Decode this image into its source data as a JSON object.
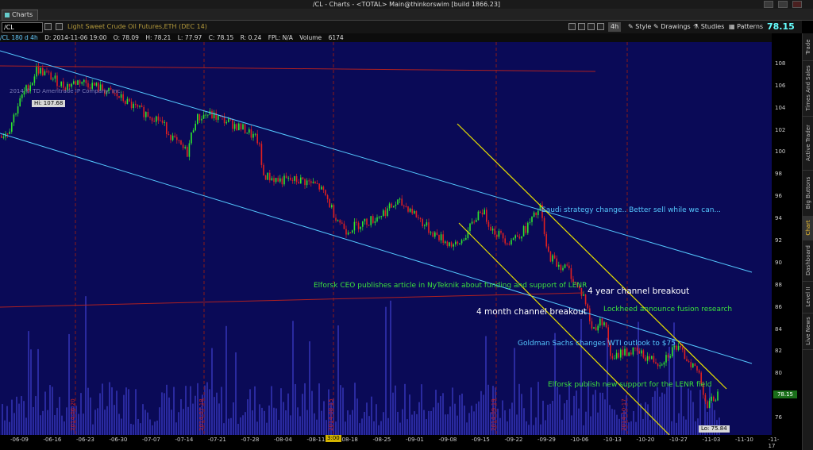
{
  "window": {
    "title": "/CL - Charts - <TOTAL> Main@thinkorswim [build 1866.23]"
  },
  "tab": {
    "label": "Charts"
  },
  "toolbar": {
    "symbol": "/CL",
    "description": "Light Sweet Crude Oil Futures,ETH (DEC 14)",
    "timeframe": "4h",
    "style": "Style",
    "drawings": "Drawings",
    "studies": "Studies",
    "patterns": "Patterns",
    "last_price": "78.15"
  },
  "info": {
    "series": "/CL 180 d 4h",
    "date": "D: 2014-11-06 19:00",
    "open": "O: 78.09",
    "high": "H: 78.21",
    "low": "L: 77.97",
    "close": "C: 78.15",
    "range": "R: 0.24",
    "fpl": "FPL: N/A",
    "volume": "Volume",
    "volume_value": "6174"
  },
  "chart": {
    "copyright": "2014 © TD Ameritrade IP Company, Inc.",
    "hi_label": "Hi: 107.68",
    "lo_label": "Lo: 75.84",
    "price_tag": "78.15",
    "marker": "3:00",
    "annotations": [
      "Saudi strategy change.. Better sell while we can...",
      "Elforsk CEO publishes article in NyTeknik about funding and support of LENR",
      "4 year channel breakout",
      "Lockheed announce fusion research",
      "4 month channel breakout",
      "Goldman Sachs changes WTI outlook to $75",
      "Elforsk publish new support for the LENR field"
    ],
    "vertical_dates": [
      "2014-06-20",
      "2014-07-18",
      "2014-08-15",
      "2014-09-19",
      "2014-10-17"
    ],
    "colors": {
      "background": "#0a0a57",
      "up": "#2ee62e",
      "down": "#e02020",
      "channel_long": "#55c8ff",
      "channel_short": "#e8e000",
      "volume": "#2a2aa0"
    }
  },
  "chart_data": {
    "type": "candlestick",
    "title": "",
    "yticks": [
      "108",
      "106",
      "104",
      "102",
      "100",
      "98",
      "96",
      "94",
      "92",
      "90",
      "88",
      "86",
      "84",
      "82",
      "80",
      "78",
      "76"
    ],
    "xticks": [
      "-06-09",
      "-06-16",
      "-06-23",
      "-06-30",
      "-07-07",
      "-07-14",
      "-07-21",
      "-07-28",
      "-08-04",
      "-08-11",
      "-08-18",
      "-08-25",
      "-09-01",
      "-09-08",
      "-09-15",
      "-09-22",
      "-09-29",
      "-10-06",
      "-10-13",
      "-10-20",
      "-10-27",
      "-11-03",
      "-11-10",
      "-11-17"
    ],
    "ylim": [
      74.5,
      110
    ],
    "path_points": [
      [
        0,
        101.5
      ],
      [
        10,
        102
      ],
      [
        20,
        104
      ],
      [
        30,
        105.5
      ],
      [
        40,
        106.5
      ],
      [
        45,
        107.6
      ],
      [
        60,
        107
      ],
      [
        80,
        106
      ],
      [
        100,
        106.5
      ],
      [
        120,
        106
      ],
      [
        150,
        105
      ],
      [
        170,
        104
      ],
      [
        200,
        103
      ],
      [
        220,
        101
      ],
      [
        235,
        100
      ],
      [
        245,
        103
      ],
      [
        260,
        103.5
      ],
      [
        280,
        103
      ],
      [
        310,
        102
      ],
      [
        325,
        101
      ],
      [
        330,
        98
      ],
      [
        350,
        97.5
      ],
      [
        380,
        97.5
      ],
      [
        400,
        97
      ],
      [
        410,
        96
      ],
      [
        420,
        94.5
      ],
      [
        435,
        93
      ],
      [
        450,
        93.5
      ],
      [
        470,
        94
      ],
      [
        500,
        95.5
      ],
      [
        515,
        95
      ],
      [
        540,
        93
      ],
      [
        560,
        92
      ],
      [
        575,
        91.5
      ],
      [
        590,
        93
      ],
      [
        605,
        95
      ],
      [
        620,
        93
      ],
      [
        640,
        92
      ],
      [
        660,
        93
      ],
      [
        680,
        95
      ],
      [
        688,
        91
      ],
      [
        700,
        90
      ],
      [
        715,
        89.5
      ],
      [
        725,
        88
      ],
      [
        735,
        87
      ],
      [
        745,
        84
      ],
      [
        760,
        85
      ],
      [
        770,
        81
      ],
      [
        780,
        82
      ],
      [
        800,
        82
      ],
      [
        830,
        81
      ],
      [
        850,
        82.5
      ],
      [
        870,
        81
      ],
      [
        880,
        80
      ],
      [
        890,
        77
      ],
      [
        900,
        78
      ],
      [
        905,
        78.15
      ]
    ]
  }
}
